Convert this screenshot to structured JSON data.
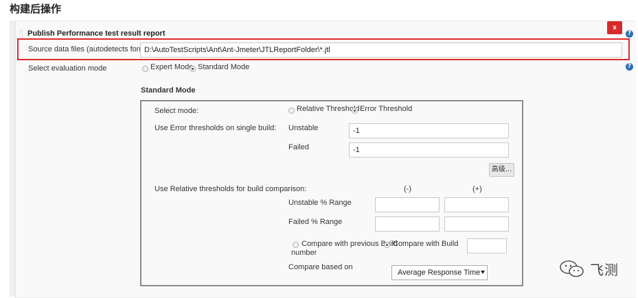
{
  "section": {
    "title": "构建后操作"
  },
  "panel": {
    "title": "Publish Performance test result report",
    "close_label": "x",
    "help_glyph": "?"
  },
  "source": {
    "label": "Source data files (autodetects format):",
    "value": "D:\\AutoTestScripts\\Ant\\Ant-Jmeter\\JTLReportFolder\\*.jtl"
  },
  "evaluation": {
    "label": "Select evaluation mode",
    "options": [
      "Expert Mode",
      "Standard Mode"
    ],
    "selected": "Standard Mode"
  },
  "standard_mode": {
    "heading": "Standard Mode",
    "select_mode_label": "Select mode:",
    "mode_options": [
      "Relative Threshold",
      "Error Threshold"
    ],
    "mode_selected": "Error Threshold",
    "error_thresholds_label": "Use Error thresholds on single build:",
    "unstable_label": "Unstable",
    "unstable_value": "-1",
    "failed_label": "Failed",
    "failed_value": "-1",
    "advanced_button": "高级...",
    "relative_label": "Use Relative thresholds for build comparison:",
    "minus_header": "(-)",
    "plus_header": "(+)",
    "unstable_range_label": "Unstable % Range",
    "failed_range_label": "Failed % Range",
    "compare_prev_label": "Compare with previous Build",
    "compare_build_label": "Compare with Build",
    "compare_build_label_2": "number",
    "compare_based_label": "Compare based on",
    "compare_based_value": "Average Response Time"
  },
  "watermark": {
    "text": "飞测"
  },
  "colors": {
    "highlight": "#e02a2a",
    "close": "#d62a2a",
    "help": "#2e6fb8"
  }
}
